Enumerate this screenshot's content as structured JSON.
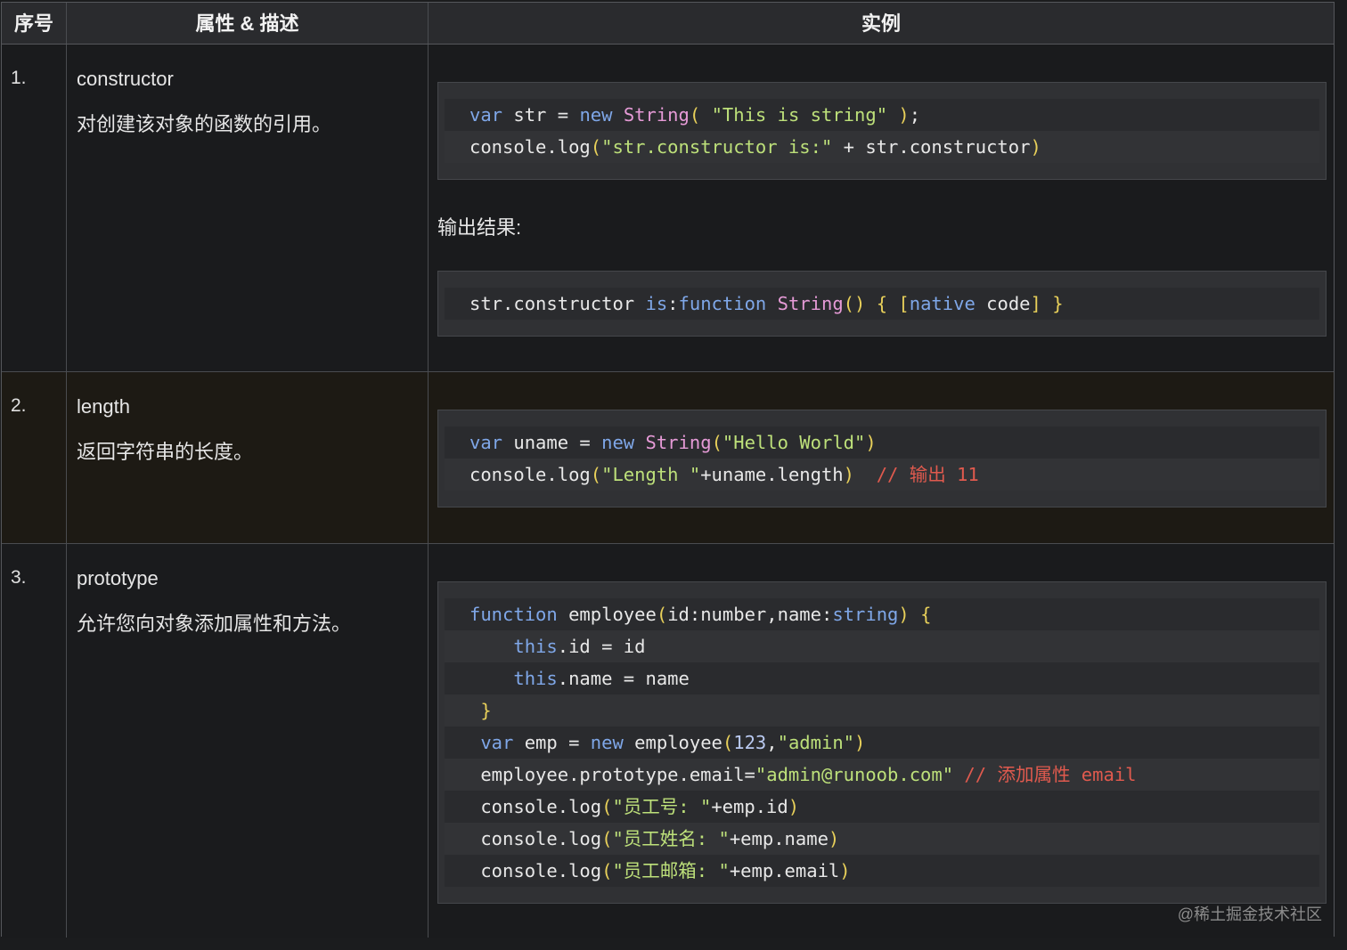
{
  "header": {
    "col_index": "序号",
    "col_attr": "属性 & 描述",
    "col_example": "实例"
  },
  "rows": [
    {
      "index": "1.",
      "name": "constructor",
      "desc": "对创建该对象的函数的引用。",
      "output_label": "输出结果:"
    },
    {
      "index": "2.",
      "name": "length",
      "desc": "返回字符串的长度。"
    },
    {
      "index": "3.",
      "name": "prototype",
      "desc": "允许您向对象添加属性和方法。"
    }
  ],
  "code": {
    "r1a": [
      "var str = new String( \"This is string\" );",
      "console.log(\"str.constructor is:\" + str.constructor)"
    ],
    "r1b": [
      "str.constructor is:function String() { [native code] }"
    ],
    "r2": [
      "var uname = new String(\"Hello World\")",
      "console.log(\"Length \"+uname.length)  // 输出 11"
    ],
    "r3": [
      "function employee(id:number,name:string) {",
      "    this.id = id",
      "    this.name = name",
      " }",
      " var emp = new employee(123,\"admin\")",
      " employee.prototype.email=\"admin@runoob.com\" // 添加属性 email",
      " console.log(\"员工号: \"+emp.id)",
      " console.log(\"员工姓名: \"+emp.name)",
      " console.log(\"员工邮箱: \"+emp.email)"
    ]
  },
  "watermark": "@稀土掘金技术社区"
}
